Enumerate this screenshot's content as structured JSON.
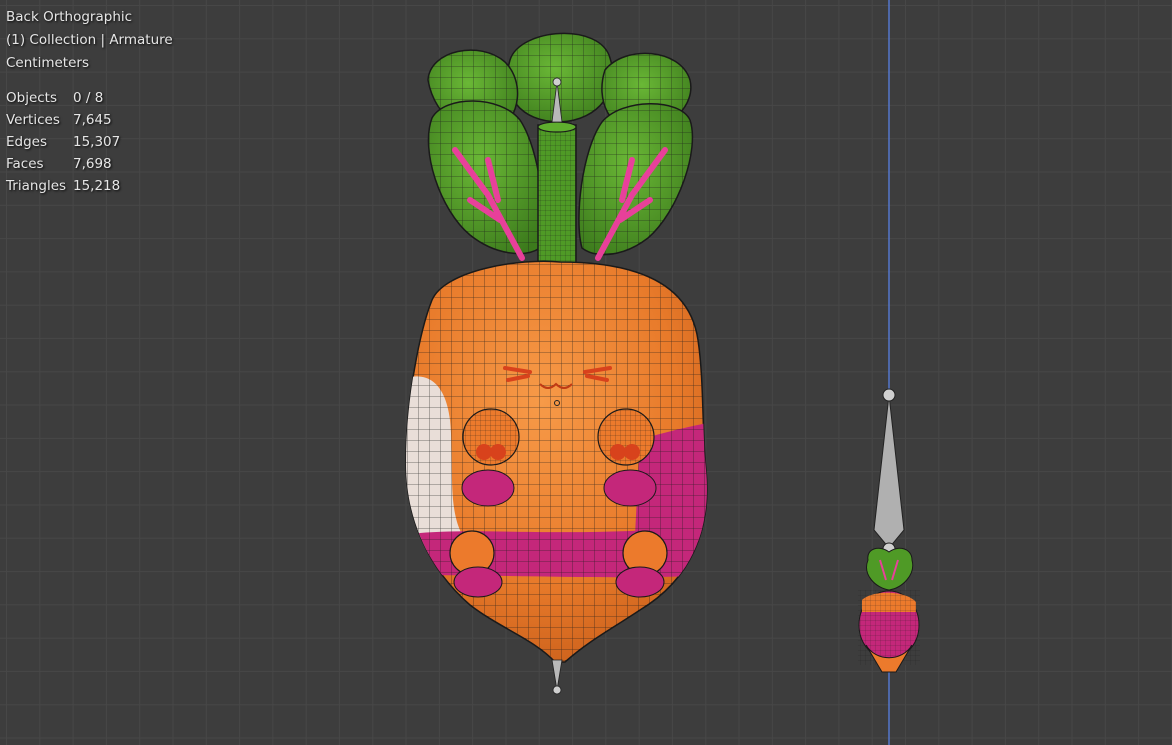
{
  "viewport": {
    "view_name": "Back Orthographic",
    "collection_info": "(1) Collection | Armature",
    "units": "Centimeters"
  },
  "stats": [
    {
      "label": "Objects",
      "value": "0 / 8"
    },
    {
      "label": "Vertices",
      "value": "7,645"
    },
    {
      "label": "Edges",
      "value": "15,307"
    },
    {
      "label": "Faces",
      "value": "7,698"
    },
    {
      "label": "Triangles",
      "value": "15,218"
    }
  ],
  "colors": {
    "background": "#3d3d3d",
    "grid": "#474747",
    "axis_line": "#5577cc",
    "leaf_green": "#5aa42c",
    "leaf_dark": "#3f7d1e",
    "stem_pink": "#e8409a",
    "body_orange": "#ec7a2c",
    "body_magenta": "#c4277a",
    "body_white": "#e9ded8",
    "bone_gray": "#b8b8b8"
  }
}
